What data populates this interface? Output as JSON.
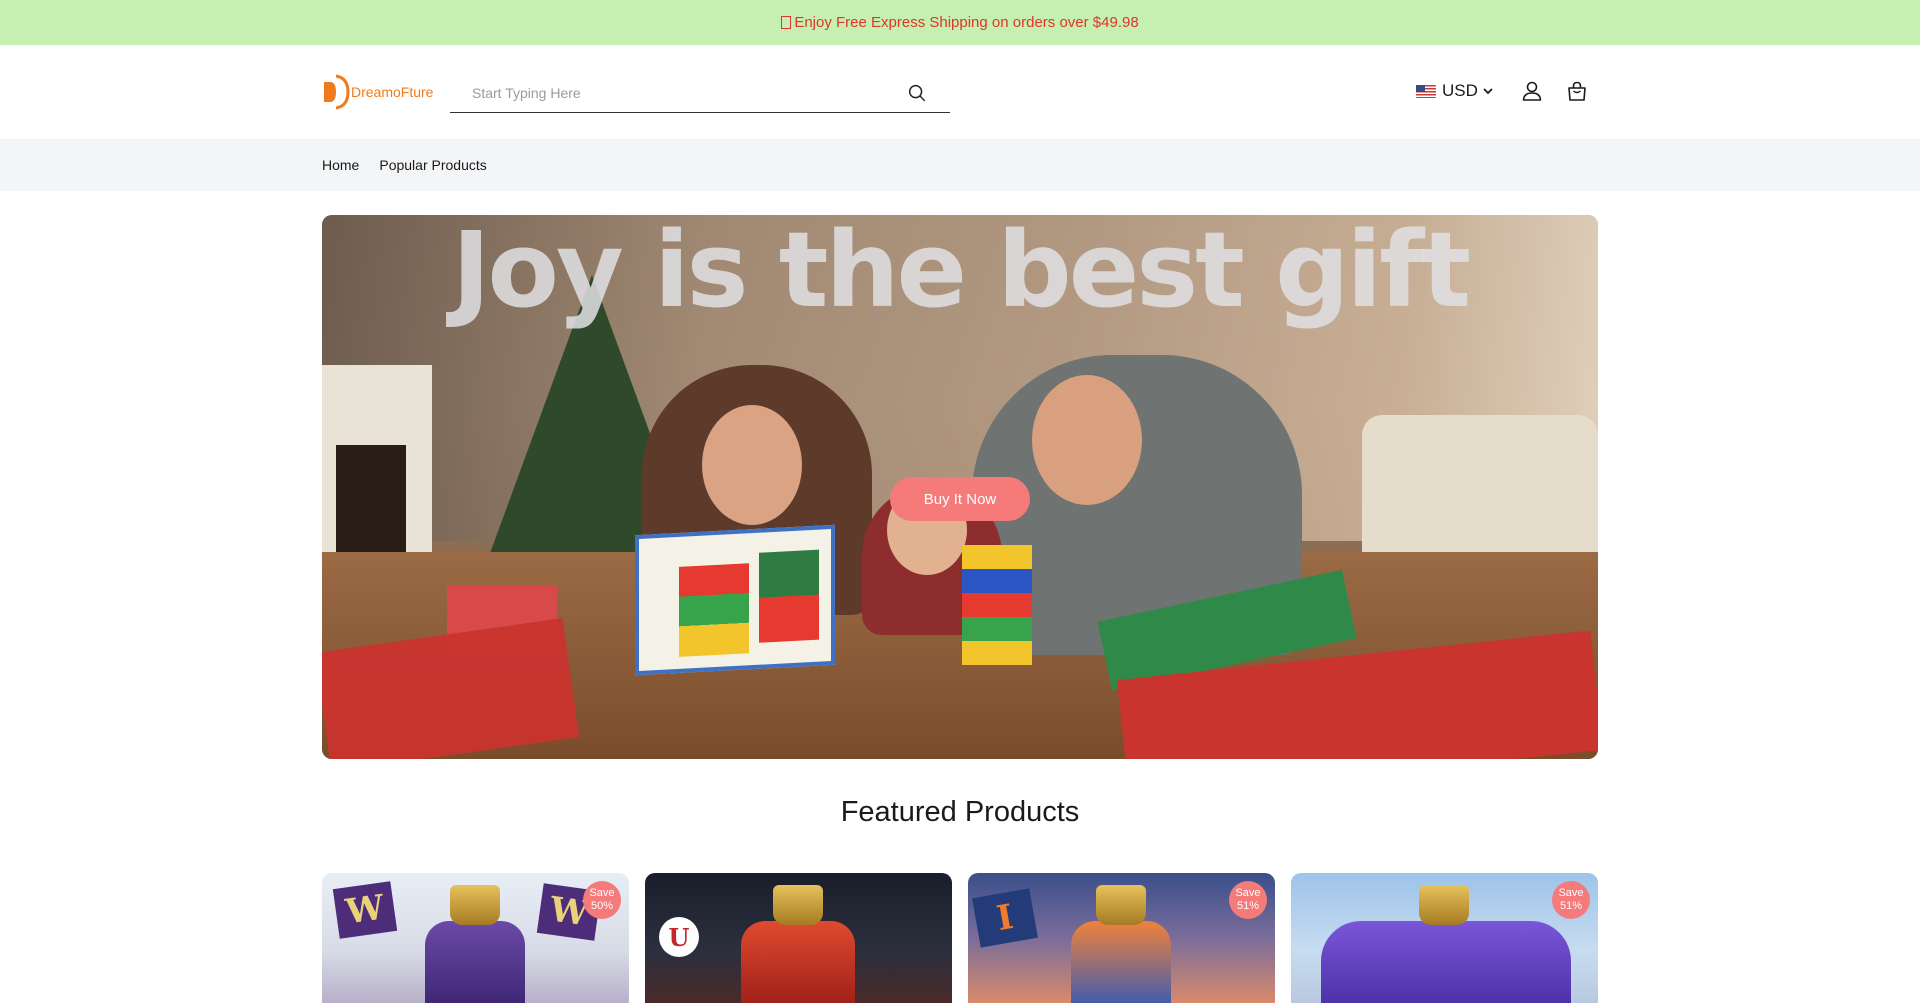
{
  "announcement": {
    "text": "Enjoy Free Express Shipping on orders over $49.98",
    "icon": "gift-icon"
  },
  "header": {
    "logo_text": "DreamoFture",
    "search_placeholder": "Start Typing Here",
    "currency": "USD",
    "icons": [
      "search-icon",
      "us-flag-icon",
      "chevron-down-icon",
      "account-icon",
      "cart-icon"
    ]
  },
  "nav": {
    "items": [
      "Home",
      "Popular Products"
    ]
  },
  "hero": {
    "title": "Joy is the best gift",
    "button_label": "Buy It Now"
  },
  "featured": {
    "heading": "Featured Products",
    "products": [
      {
        "badge_line1": "Save",
        "badge_line2": "50%"
      },
      {
        "badge_line1": "",
        "badge_line2": ""
      },
      {
        "badge_line1": "Save",
        "badge_line2": "51%"
      },
      {
        "badge_line1": "Save",
        "badge_line2": "51%"
      }
    ]
  },
  "colors": {
    "announcement_bg": "#c6f0b1",
    "announcement_text": "#e0342c",
    "brand": "#f07b1c",
    "accent": "#f57a7a",
    "nav_bg": "#f4f5f7"
  }
}
